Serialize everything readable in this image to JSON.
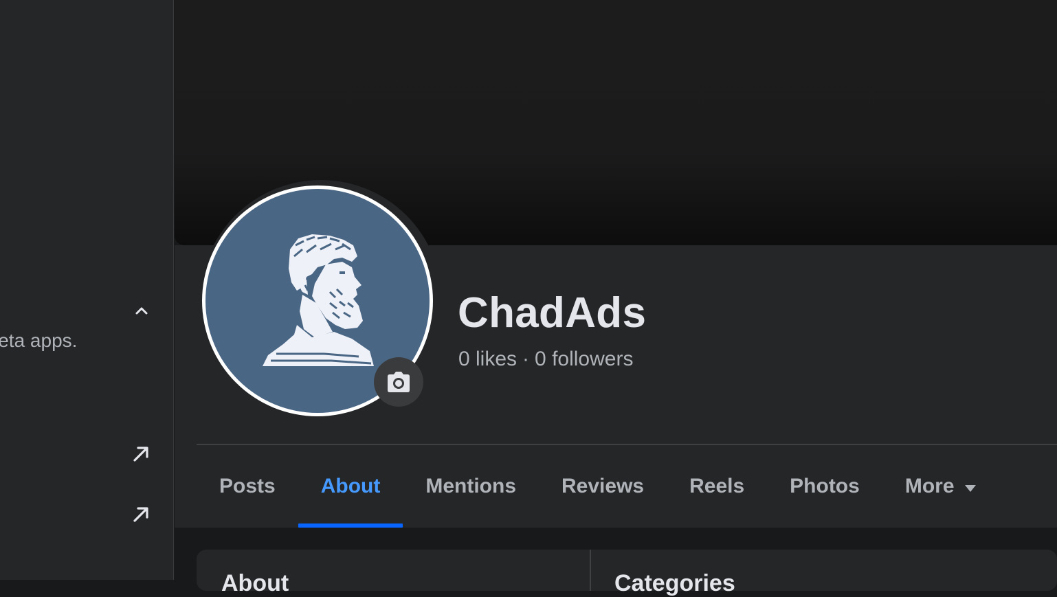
{
  "sidebar": {
    "partial_text": "leta apps.",
    "collapse_icon": "chevron-up-icon",
    "external_icon": "arrow-up-right-icon"
  },
  "profile": {
    "name": "ChadAds",
    "likes": "0 likes",
    "separator": "·",
    "followers": "0 followers",
    "avatar_icon": "bearded-man-bust-icon",
    "camera_icon": "camera-icon"
  },
  "tabs": [
    {
      "label": "Posts",
      "active": false
    },
    {
      "label": "About",
      "active": true
    },
    {
      "label": "Mentions",
      "active": false
    },
    {
      "label": "Reviews",
      "active": false
    },
    {
      "label": "Reels",
      "active": false
    },
    {
      "label": "Photos",
      "active": false
    },
    {
      "label": "More",
      "active": false
    }
  ],
  "content": {
    "about_title": "About",
    "category_title": "Categories"
  },
  "colors": {
    "accent": "#0866ff",
    "active_tab_text": "#4599ff",
    "avatar_bg": "#4a6685",
    "panel_bg": "#242628"
  }
}
